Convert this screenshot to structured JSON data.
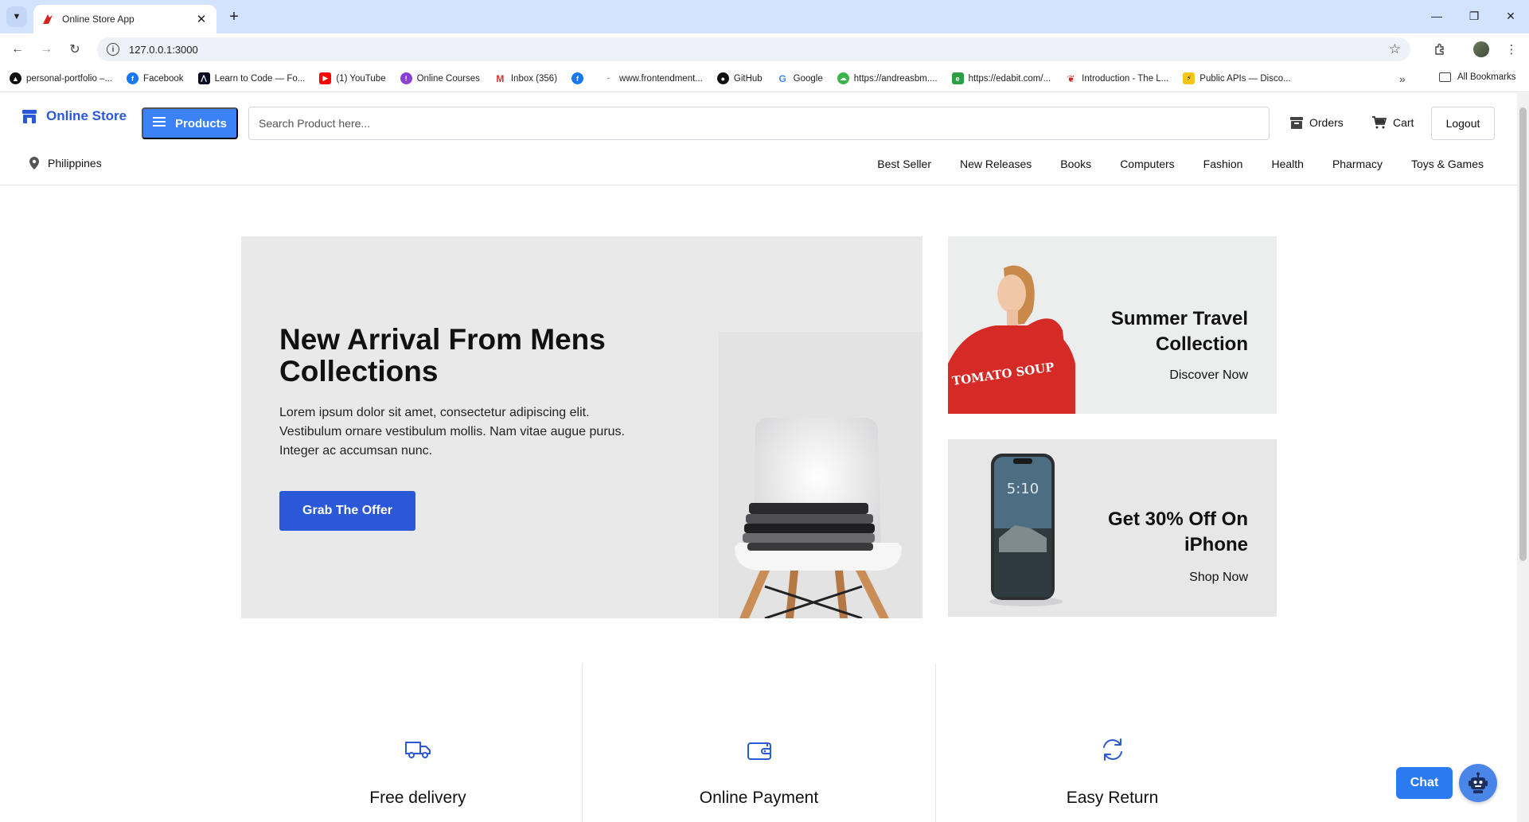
{
  "browser": {
    "tab_title": "Online Store App",
    "url": "127.0.0.1:3000",
    "bookmarks": [
      "personal-portfolio –...",
      "Facebook",
      "Learn to Code — Fo...",
      "(1) YouTube",
      "Online Courses",
      "Inbox (356)",
      "",
      "www.frontendment...",
      "GitHub",
      "Google",
      "https://andreasbm....",
      "https://edabit.com/...",
      "Introduction - The L...",
      "Public APIs — Disco..."
    ],
    "all_bookmarks": "All Bookmarks"
  },
  "header": {
    "logo": "Online Store",
    "products_label": "Products",
    "search_placeholder": "Search Product here...",
    "orders": "Orders",
    "cart": "Cart",
    "logout": "Logout",
    "location": "Philippines",
    "categories": [
      "Best Seller",
      "New Releases",
      "Books",
      "Computers",
      "Fashion",
      "Health",
      "Pharmacy",
      "Toys & Games"
    ]
  },
  "hero": {
    "title": "New Arrival From Mens Collections",
    "text": "Lorem ipsum dolor sit amet, consectetur adipiscing elit. Vestibulum ornare vestibulum mollis. Nam vitae augue purus. Integer ac accumsan nunc.",
    "button": "Grab The Offer"
  },
  "promos": [
    {
      "title": "Summer Travel Collection",
      "link": "Discover Now",
      "shirt_text": "TOMATO SOUP"
    },
    {
      "title": "Get 30% Off On iPhone",
      "link": "Shop Now",
      "phone_time": "5:10"
    }
  ],
  "features": [
    {
      "title": "Free delivery",
      "icon": "truck-icon"
    },
    {
      "title": "Online Payment",
      "icon": "wallet-icon"
    },
    {
      "title": "Easy Return",
      "icon": "refresh-icon"
    }
  ],
  "chat": {
    "label": "Chat"
  },
  "colors": {
    "brand": "#2b58d6",
    "products_btn": "#3b82f6",
    "chat": "#2b7bf0"
  }
}
